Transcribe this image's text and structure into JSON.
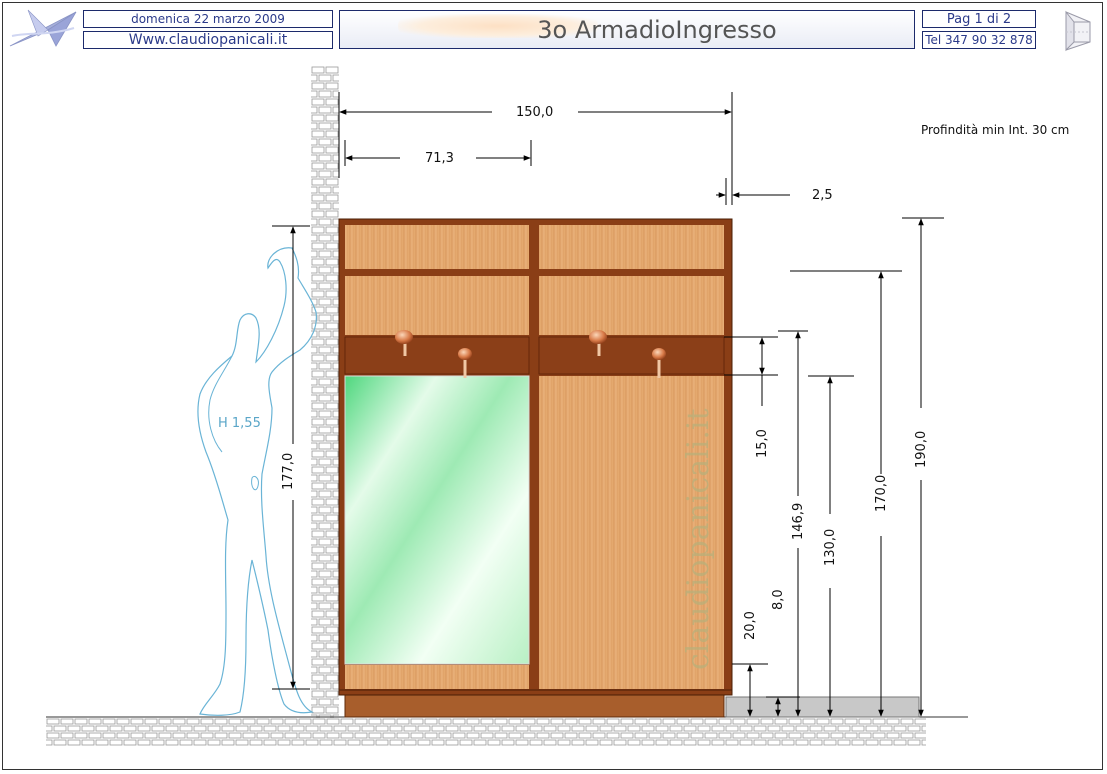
{
  "header": {
    "date": "domenica 22 marzo 2009",
    "website": "Www.claudiopanicali.it",
    "title": "3o ArmadioIngresso",
    "page": "Pag 1 di 2",
    "phone": "Tel 347 90 32 878",
    "logo_icon": "paper-plane-logo-icon",
    "corner_icon": "perspective-cube-icon"
  },
  "drawing": {
    "note": "Profindità min Int. 30 cm",
    "figure_label": "H 1,55",
    "watermark": "claudiopanicali.it",
    "dimensions": {
      "total_width": "150,0",
      "door_width": "71,3",
      "thickness": "2,5",
      "figure_height": "177,0",
      "hook_rail": "15,0",
      "hook_rail_top": "146,9",
      "hook_rail_bottom": "130,0",
      "top_shelf": "170,0",
      "total_height": "190,0",
      "base_plinth": "20,0",
      "step": "8,0"
    },
    "colors": {
      "wood": "#e2a468",
      "wood_dark": "#7a3a12",
      "rail": "#8b3f18",
      "mirror": "#bff2c8",
      "figure": "#6ab4d6",
      "brick": "#9a9a9a"
    }
  }
}
